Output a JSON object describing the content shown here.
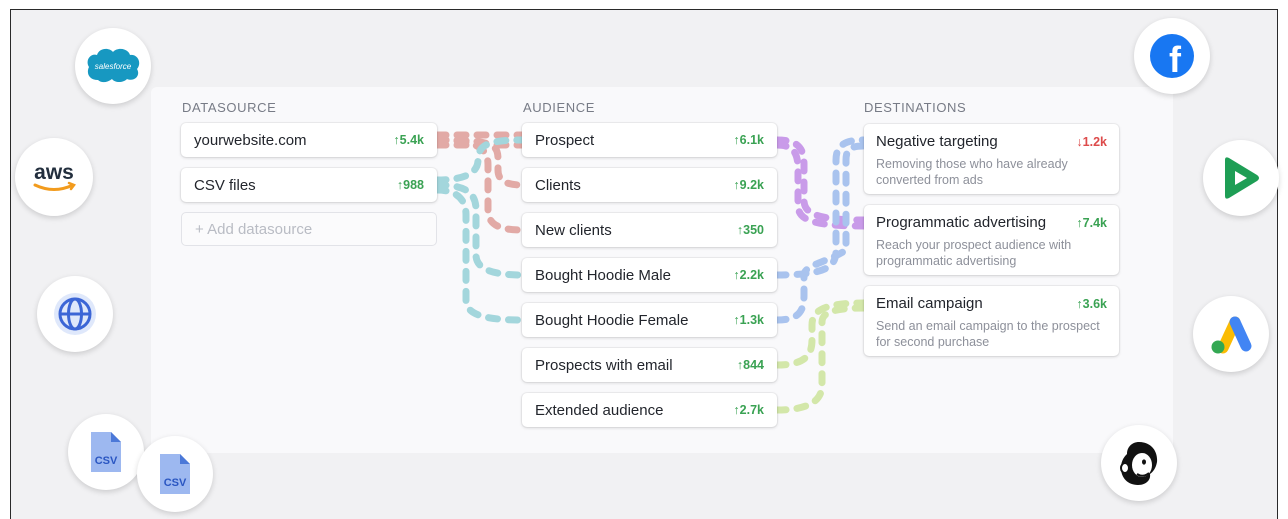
{
  "columns": {
    "datasource": "DATASOURCE",
    "audience": "AUDIENCE",
    "destinations": "DESTINATIONS"
  },
  "datasources": [
    {
      "label": "yourwebsite.com",
      "metric": "5.4k",
      "color": "#e0a7a3"
    },
    {
      "label": "CSV files",
      "metric": "988",
      "color": "#9fd3d9"
    }
  ],
  "add_datasource": "+ Add datasource",
  "audiences": [
    {
      "label": "Prospect",
      "metric": "6.1k"
    },
    {
      "label": "Clients",
      "metric": "9.2k"
    },
    {
      "label": "New clients",
      "metric": "350"
    },
    {
      "label": "Bought Hoodie Male",
      "metric": "2.2k"
    },
    {
      "label": "Bought Hoodie Female",
      "metric": "1.3k"
    },
    {
      "label": "Prospects with email",
      "metric": "844"
    },
    {
      "label": "Extended audience",
      "metric": "2.7k"
    }
  ],
  "destinations": [
    {
      "title": "Negative targeting",
      "metric": "1.2k",
      "direction": "down",
      "description": "Removing those who have already converted from ads"
    },
    {
      "title": "Programmatic advertising",
      "metric": "7.4k",
      "direction": "up",
      "description": "Reach your prospect audience with programmatic advertising"
    },
    {
      "title": "Email campaign",
      "metric": "3.6k",
      "direction": "up",
      "description": "Send an email campaign to the prospect for second purchase"
    }
  ],
  "arrows": {
    "up": "↑",
    "down": "↓"
  },
  "logos": {
    "salesforce": {
      "icon": "salesforce-icon",
      "text": "salesforce",
      "color": "#1798c1"
    },
    "aws": {
      "icon": "aws-icon",
      "text": "aws",
      "color": "#232f3e"
    },
    "globe": {
      "icon": "globe-icon",
      "color": "#3c66d6"
    },
    "csv": {
      "icon": "csv-file-icon",
      "text": "CSV",
      "color": "#4b78d8"
    },
    "facebook": {
      "icon": "facebook-icon",
      "text": "f",
      "color": "#1877f2"
    },
    "play": {
      "icon": "google-play-icon",
      "color": "#1e9e55"
    },
    "google_ads": {
      "icon": "google-ads-icon"
    },
    "mailchimp": {
      "icon": "mailchimp-icon"
    }
  },
  "flow_colors": {
    "website": "#e2aaa6",
    "csv": "#a3d6dc",
    "prospect": "#c99be9",
    "hoodie": "#a9c3ee",
    "email": "#d3e7a9"
  }
}
